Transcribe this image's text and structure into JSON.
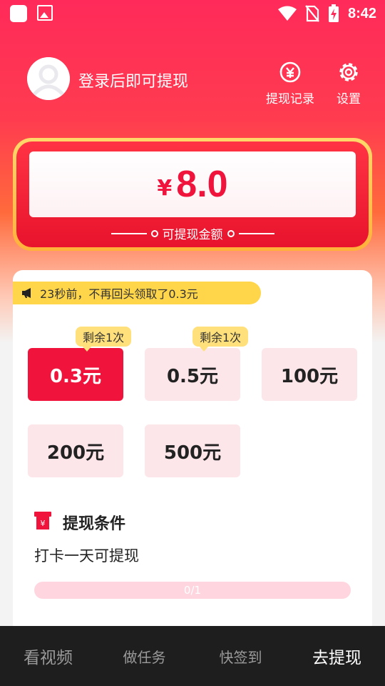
{
  "status_bar": {
    "time": "8:42"
  },
  "header": {
    "login_prompt": "登录后即可提现",
    "records_label": "提现记录",
    "settings_label": "设置"
  },
  "balance": {
    "currency": "¥",
    "amount": "8.0",
    "label": "可提现金额"
  },
  "notice": {
    "text": "23秒前，不再回头领取了0.3元"
  },
  "options": [
    {
      "label": "0.3元",
      "tag": "剩余1次",
      "selected": true
    },
    {
      "label": "0.5元",
      "tag": "剩余1次",
      "selected": false
    },
    {
      "label": "100元",
      "tag": "",
      "selected": false
    },
    {
      "label": "200元",
      "tag": "",
      "selected": false
    },
    {
      "label": "500元",
      "tag": "",
      "selected": false
    }
  ],
  "condition": {
    "title": "提现条件",
    "text": "打卡一天可提现",
    "progress_text": "0/1",
    "progress_fraction": 0
  },
  "bottom_nav": {
    "items": [
      "看视频",
      "做任务",
      "快签到",
      "去提现"
    ],
    "active_index": 3
  },
  "colors": {
    "accent": "#f0143c",
    "tag": "#ffe07a",
    "notice": "#ffd54a"
  }
}
